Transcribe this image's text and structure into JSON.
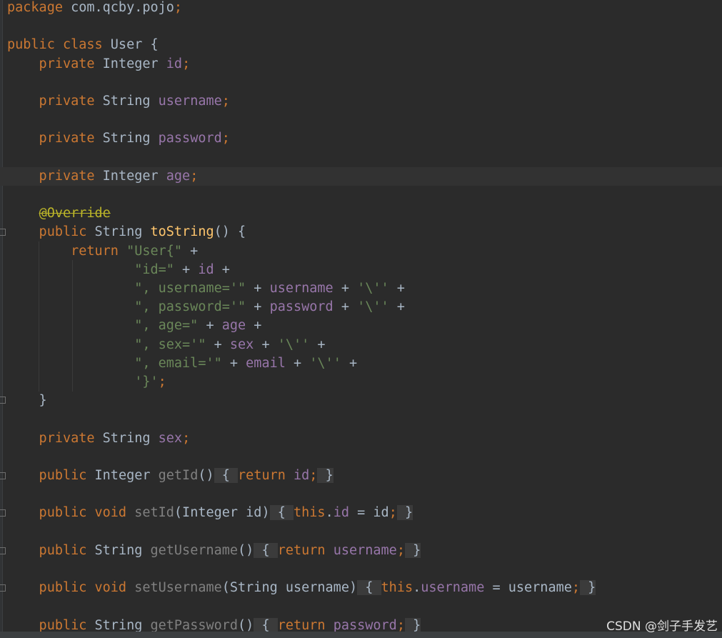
{
  "editor": {
    "lines": [
      {
        "tokens": [
          {
            "t": "package",
            "c": "kw"
          },
          {
            "t": " com.qcby.pojo",
            "c": "plain"
          },
          {
            "t": ";",
            "c": "kw"
          }
        ]
      },
      {
        "tokens": []
      },
      {
        "tokens": [
          {
            "t": "public class",
            "c": "kw"
          },
          {
            "t": " User {",
            "c": "plain"
          }
        ]
      },
      {
        "tokens": [
          {
            "t": "    private",
            "c": "kw"
          },
          {
            "t": " Integer ",
            "c": "plain"
          },
          {
            "t": "id",
            "c": "field"
          },
          {
            "t": ";",
            "c": "kw"
          }
        ]
      },
      {
        "tokens": []
      },
      {
        "tokens": [
          {
            "t": "    private",
            "c": "kw"
          },
          {
            "t": " String ",
            "c": "plain"
          },
          {
            "t": "username",
            "c": "field"
          },
          {
            "t": ";",
            "c": "kw"
          }
        ]
      },
      {
        "tokens": []
      },
      {
        "tokens": [
          {
            "t": "    private",
            "c": "kw"
          },
          {
            "t": " String ",
            "c": "plain"
          },
          {
            "t": "password",
            "c": "field"
          },
          {
            "t": ";",
            "c": "kw"
          }
        ]
      },
      {
        "tokens": []
      },
      {
        "tokens": [
          {
            "t": "    private",
            "c": "kw"
          },
          {
            "t": " Integer ",
            "c": "plain"
          },
          {
            "t": "age",
            "c": "field"
          },
          {
            "t": ";",
            "c": "kw"
          }
        ],
        "highlight": true
      },
      {
        "tokens": []
      },
      {
        "tokens": [
          {
            "t": "    ",
            "c": "plain"
          },
          {
            "t": "@Override",
            "c": "ann"
          }
        ]
      },
      {
        "tokens": [
          {
            "t": "    public",
            "c": "kw"
          },
          {
            "t": " String ",
            "c": "plain"
          },
          {
            "t": "toString",
            "c": "method"
          },
          {
            "t": "() {",
            "c": "plain"
          }
        ]
      },
      {
        "tokens": [
          {
            "t": "        return ",
            "c": "kw"
          },
          {
            "t": "\"User{\"",
            "c": "str"
          },
          {
            "t": " +",
            "c": "plain"
          }
        ]
      },
      {
        "tokens": [
          {
            "t": "                ",
            "c": "plain"
          },
          {
            "t": "\"id=\"",
            "c": "str"
          },
          {
            "t": " + ",
            "c": "plain"
          },
          {
            "t": "id",
            "c": "field"
          },
          {
            "t": " +",
            "c": "plain"
          }
        ]
      },
      {
        "tokens": [
          {
            "t": "                ",
            "c": "plain"
          },
          {
            "t": "\", username='\"",
            "c": "str"
          },
          {
            "t": " + ",
            "c": "plain"
          },
          {
            "t": "username",
            "c": "field"
          },
          {
            "t": " + ",
            "c": "plain"
          },
          {
            "t": "'\\''",
            "c": "str"
          },
          {
            "t": " +",
            "c": "plain"
          }
        ]
      },
      {
        "tokens": [
          {
            "t": "                ",
            "c": "plain"
          },
          {
            "t": "\", password='\"",
            "c": "str"
          },
          {
            "t": " + ",
            "c": "plain"
          },
          {
            "t": "password",
            "c": "field"
          },
          {
            "t": " + ",
            "c": "plain"
          },
          {
            "t": "'\\''",
            "c": "str"
          },
          {
            "t": " +",
            "c": "plain"
          }
        ]
      },
      {
        "tokens": [
          {
            "t": "                ",
            "c": "plain"
          },
          {
            "t": "\", age=\"",
            "c": "str"
          },
          {
            "t": " + ",
            "c": "plain"
          },
          {
            "t": "age",
            "c": "field"
          },
          {
            "t": " +",
            "c": "plain"
          }
        ]
      },
      {
        "tokens": [
          {
            "t": "                ",
            "c": "plain"
          },
          {
            "t": "\", sex='\"",
            "c": "str"
          },
          {
            "t": " + ",
            "c": "plain"
          },
          {
            "t": "sex",
            "c": "field"
          },
          {
            "t": " + ",
            "c": "plain"
          },
          {
            "t": "'\\''",
            "c": "str"
          },
          {
            "t": " +",
            "c": "plain"
          }
        ]
      },
      {
        "tokens": [
          {
            "t": "                ",
            "c": "plain"
          },
          {
            "t": "\", email='\"",
            "c": "str"
          },
          {
            "t": " + ",
            "c": "plain"
          },
          {
            "t": "email",
            "c": "field"
          },
          {
            "t": " + ",
            "c": "plain"
          },
          {
            "t": "'\\''",
            "c": "str"
          },
          {
            "t": " +",
            "c": "plain"
          }
        ]
      },
      {
        "tokens": [
          {
            "t": "                ",
            "c": "plain"
          },
          {
            "t": "'}'",
            "c": "str"
          },
          {
            "t": ";",
            "c": "kw"
          }
        ]
      },
      {
        "tokens": [
          {
            "t": "    }",
            "c": "plain"
          }
        ]
      },
      {
        "tokens": []
      },
      {
        "tokens": [
          {
            "t": "    private",
            "c": "kw"
          },
          {
            "t": " String ",
            "c": "plain"
          },
          {
            "t": "sex",
            "c": "field"
          },
          {
            "t": ";",
            "c": "kw"
          }
        ]
      },
      {
        "tokens": []
      },
      {
        "tokens": [
          {
            "t": "    public",
            "c": "kw"
          },
          {
            "t": " Integer ",
            "c": "plain"
          },
          {
            "t": "getId",
            "c": "methodDim"
          },
          {
            "t": "()",
            "c": "plain"
          },
          {
            "t": " { ",
            "c": "fold"
          },
          {
            "t": "return ",
            "c": "kw"
          },
          {
            "t": "id",
            "c": "field"
          },
          {
            "t": ";",
            "c": "kw"
          },
          {
            "t": " }",
            "c": "fold"
          }
        ]
      },
      {
        "tokens": []
      },
      {
        "tokens": [
          {
            "t": "    public void",
            "c": "kw"
          },
          {
            "t": " ",
            "c": "plain"
          },
          {
            "t": "setId",
            "c": "methodDim"
          },
          {
            "t": "(Integer id)",
            "c": "plain"
          },
          {
            "t": " { ",
            "c": "fold"
          },
          {
            "t": "this",
            "c": "kw"
          },
          {
            "t": ".",
            "c": "plain"
          },
          {
            "t": "id",
            "c": "field"
          },
          {
            "t": " = id",
            "c": "plain"
          },
          {
            "t": ";",
            "c": "kw"
          },
          {
            "t": " }",
            "c": "fold"
          }
        ]
      },
      {
        "tokens": []
      },
      {
        "tokens": [
          {
            "t": "    public",
            "c": "kw"
          },
          {
            "t": " String ",
            "c": "plain"
          },
          {
            "t": "getUsername",
            "c": "methodDim"
          },
          {
            "t": "()",
            "c": "plain"
          },
          {
            "t": " { ",
            "c": "fold"
          },
          {
            "t": "return ",
            "c": "kw"
          },
          {
            "t": "username",
            "c": "field"
          },
          {
            "t": ";",
            "c": "kw"
          },
          {
            "t": " }",
            "c": "fold"
          }
        ]
      },
      {
        "tokens": []
      },
      {
        "tokens": [
          {
            "t": "    public void",
            "c": "kw"
          },
          {
            "t": " ",
            "c": "plain"
          },
          {
            "t": "setUsername",
            "c": "methodDim"
          },
          {
            "t": "(String username)",
            "c": "plain"
          },
          {
            "t": " { ",
            "c": "fold"
          },
          {
            "t": "this",
            "c": "kw"
          },
          {
            "t": ".",
            "c": "plain"
          },
          {
            "t": "username",
            "c": "field"
          },
          {
            "t": " = username",
            "c": "plain"
          },
          {
            "t": ";",
            "c": "kw"
          },
          {
            "t": " }",
            "c": "fold"
          }
        ]
      },
      {
        "tokens": []
      },
      {
        "tokens": [
          {
            "t": "    public",
            "c": "kw"
          },
          {
            "t": " String ",
            "c": "plain"
          },
          {
            "t": "getPassword",
            "c": "methodDim"
          },
          {
            "t": "()",
            "c": "plain"
          },
          {
            "t": " { ",
            "c": "fold"
          },
          {
            "t": "return ",
            "c": "kw"
          },
          {
            "t": "password",
            "c": "field"
          },
          {
            "t": ";",
            "c": "kw"
          },
          {
            "t": " }",
            "c": "fold"
          }
        ]
      }
    ]
  },
  "watermark": "CSDN @剑子手发艺",
  "colors": {
    "background": "#2b2b2b",
    "keyword": "#cc7832",
    "field": "#9876aa",
    "string": "#6a8759",
    "method": "#ffc66d",
    "annotation": "#bbb529"
  }
}
